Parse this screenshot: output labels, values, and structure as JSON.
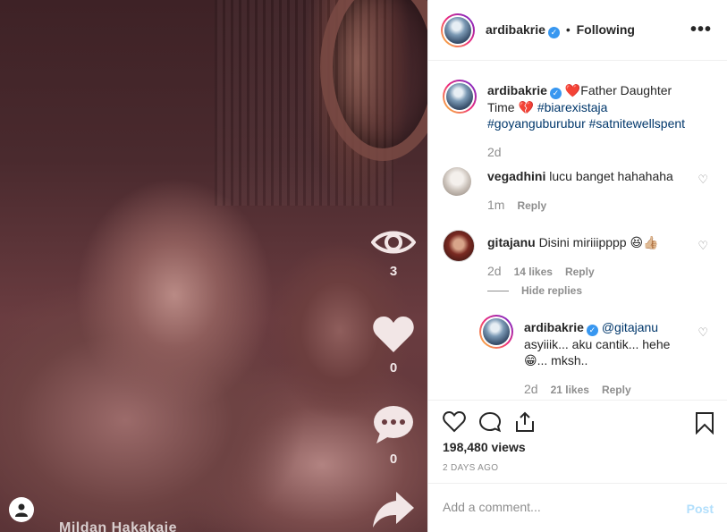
{
  "media": {
    "views_count": "3",
    "likes_count": "0",
    "comments_count": "0",
    "overlay_text": "Mildan Hakakaie"
  },
  "header": {
    "username": "ardibakrie",
    "separator": "•",
    "follow_status": "Following",
    "more_label": "•••"
  },
  "caption": {
    "username": "ardibakrie",
    "text_start": "Father Daughter Time",
    "hashtags": "#biarexistaja #goyanguburubur #satnitewellspent",
    "time": "2d"
  },
  "comments": [
    {
      "username": "vegadhini",
      "text": "lucu banget hahahaha",
      "time": "1m",
      "reply_label": "Reply"
    },
    {
      "username": "gitajanu",
      "text": "Disini miriiipppp 😆👍🏼",
      "time": "2d",
      "likes": "14 likes",
      "reply_label": "Reply",
      "hide_replies": "Hide replies"
    }
  ],
  "reply": {
    "username": "ardibakrie",
    "mention": "@gitajanu",
    "text": "asyiiik... aku cantik... hehe 😁... mksh..",
    "time": "2d",
    "likes": "21 likes",
    "reply_label": "Reply"
  },
  "actions": {
    "views": "198,480 views",
    "ago": "2 DAYS AGO"
  },
  "add_comment": {
    "placeholder": "Add a comment...",
    "post_label": "Post"
  },
  "colors": {
    "accent": "#3897f0",
    "link": "#00376b",
    "muted": "#8e8e8e",
    "post_disabled": "#b2dffc"
  }
}
